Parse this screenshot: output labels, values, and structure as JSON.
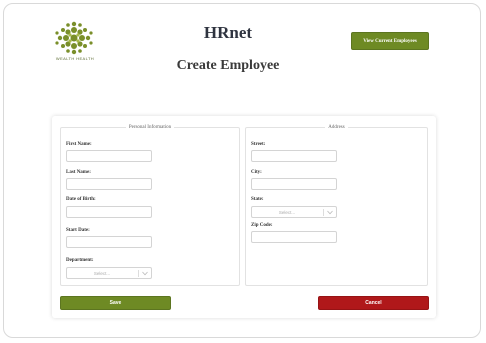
{
  "header": {
    "logo_text": "WEALTH HEALTH",
    "app_title": "HRnet",
    "view_employees_label": "View Current Employees"
  },
  "form": {
    "title": "Create Employee",
    "personal": {
      "legend": "Personal Information",
      "first_name_label": "First Name:",
      "last_name_label": "Last Name:",
      "dob_label": "Date of Birth:",
      "start_date_label": "Start Date:",
      "department_label": "Department:",
      "department_placeholder": "Select..."
    },
    "address": {
      "legend": "Address",
      "street_label": "Street:",
      "city_label": "City:",
      "state_label": "State:",
      "state_placeholder": "Select...",
      "zip_label": "Zip Code:"
    },
    "save_label": "Save",
    "cancel_label": "Cancel"
  },
  "colors": {
    "primary_green": "#6e8a24",
    "danger_red": "#b0181a"
  },
  "icons": {
    "logo": "tree-logo-icon",
    "dropdown": "chevron-down-icon"
  }
}
